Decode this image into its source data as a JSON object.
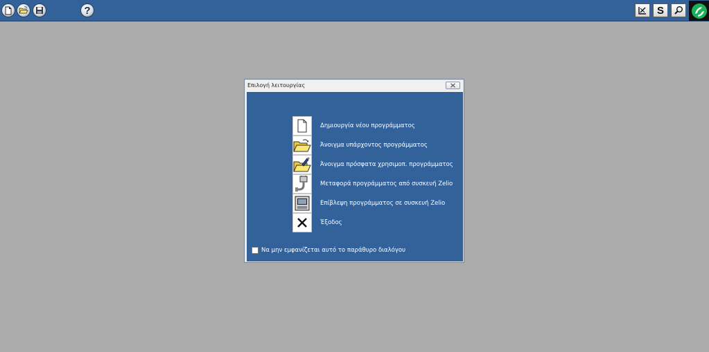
{
  "toolbar": {
    "left_icons": [
      "new-document-icon",
      "open-folder-icon",
      "save-disk-icon",
      "help-icon"
    ],
    "help_glyph": "?",
    "right_icons": [
      "edit-program-icon",
      "simulation-icon",
      "zoom-icon"
    ],
    "sim_glyph": "S"
  },
  "dialog": {
    "title": "Επιλογή λειτουργίας",
    "options": [
      {
        "label": "Δημιουργία νέου προγράμματος",
        "icon": "new-document-icon"
      },
      {
        "label": "Άνοιγμα υπάρχοντος προγράμματος",
        "icon": "open-folder-icon"
      },
      {
        "label": "Άνοιγμα πρόσφατα χρησιμοπ. προγράμματος",
        "icon": "recent-folder-icon"
      },
      {
        "label": "Μεταφορά προγράμματος από συσκευή Zelio",
        "icon": "transfer-plug-icon"
      },
      {
        "label": "Επίβλεψη προγράμματος σε συσκευή Zelio",
        "icon": "monitor-device-icon"
      },
      {
        "label": "Έξοδος",
        "icon": "exit-x-icon"
      }
    ],
    "dont_show_label": "Να μην εμφανίζεται αυτό το παράθυρο διαλόγου",
    "dont_show_checked": false
  },
  "colors": {
    "background": "#ababab",
    "toolbar": "#33629a",
    "dialog_panel": "#33629a",
    "text_light": "#ffffff"
  }
}
